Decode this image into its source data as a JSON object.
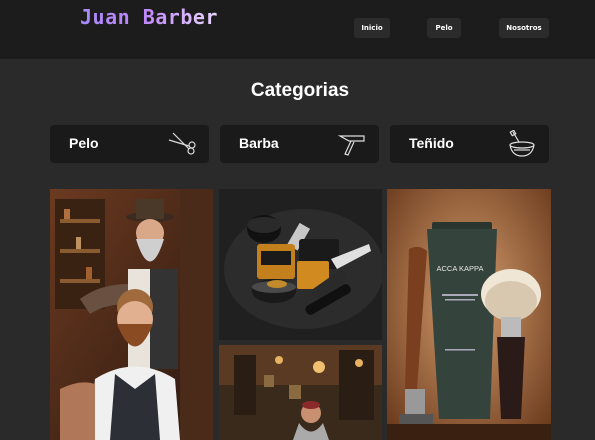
{
  "header": {
    "logo": "Juan Barber",
    "nav": [
      "Inicio",
      "Pelo",
      "Nosotros"
    ]
  },
  "main": {
    "title": "Categorias",
    "categories": [
      {
        "label": "Pelo",
        "icon": "scissors-icon"
      },
      {
        "label": "Barba",
        "icon": "razor-icon"
      },
      {
        "label": "Teñido",
        "icon": "dye-bowl-icon"
      }
    ],
    "product_tube_text": "ACCA KAPPA"
  },
  "colors": {
    "page_bg": "#2a2a2a",
    "header_bg": "#1c1c1c",
    "card_bg": "#1a1a1a",
    "logo_gradient": [
      "#a78bfa",
      "#e9d5ff"
    ]
  }
}
